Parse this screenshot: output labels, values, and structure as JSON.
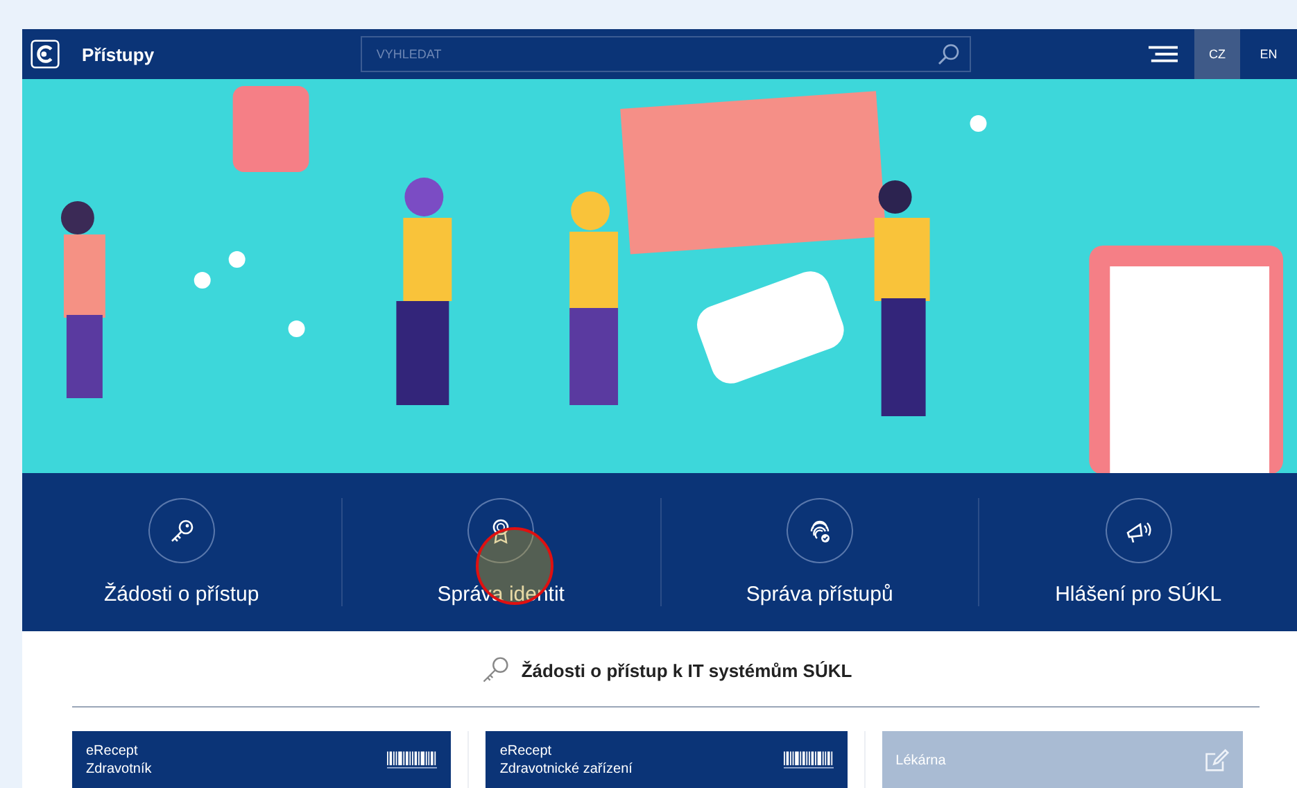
{
  "header": {
    "title": "Přístupy",
    "search": {
      "placeholder": "VYHLEDAT"
    },
    "languages": [
      {
        "label": "CZ",
        "selected": true
      },
      {
        "label": "EN",
        "selected": false
      }
    ]
  },
  "nav": [
    {
      "label": "Žádosti o přístup",
      "kind": "key"
    },
    {
      "label": "Správa identit",
      "kind": "badge"
    },
    {
      "label": "Správa přístupů",
      "kind": "fingerprint"
    },
    {
      "label": "Hlášení pro SÚKL",
      "kind": "megaphone"
    }
  ],
  "section": {
    "title": "Žádosti o přístup k IT systémům SÚKL"
  },
  "cards": [
    {
      "lines": [
        "eRecept",
        "Zdravotník"
      ],
      "kind": "barcode",
      "disabled": false
    },
    {
      "lines": [
        "eRecept",
        "Zdravotnické zařízení"
      ],
      "kind": "barcode",
      "disabled": false
    },
    {
      "lines": [
        "Lékárna"
      ],
      "kind": "edit",
      "disabled": true
    }
  ]
}
